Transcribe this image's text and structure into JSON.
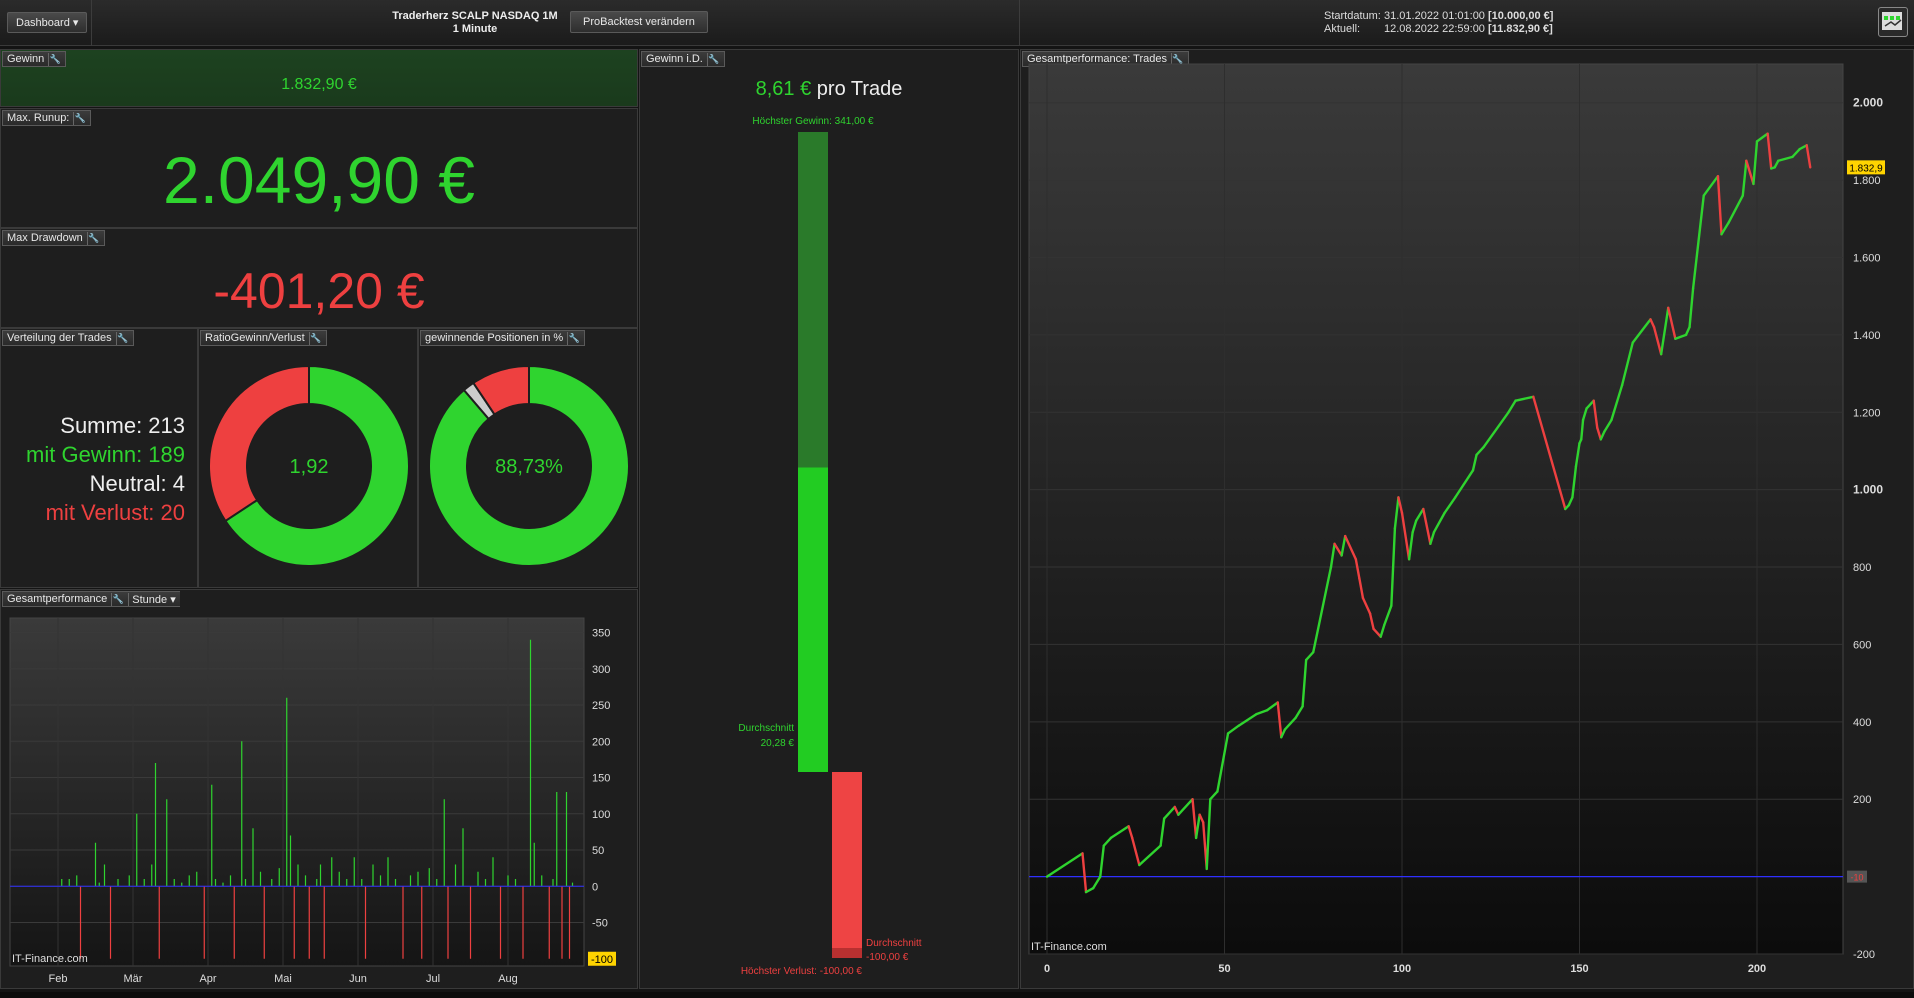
{
  "topbar": {
    "dashboard_label": "Dashboard",
    "title_line1": "Traderherz SCALP NASDAQ 1M",
    "title_line2": "1 Minute",
    "probacktest_label": "ProBacktest verändern",
    "start_label": "Startdatum:",
    "start_date": "31.01.2022 01:01:00",
    "start_value": "[10.000,00 €]",
    "current_label": "Aktuell:",
    "current_date": "12.08.2022 22:59:00",
    "current_value": "[11.832,90 €]"
  },
  "gewinn": {
    "title": "Gewinn",
    "value": "1.832,90 €"
  },
  "runup": {
    "title": "Max. Runup:",
    "value": "2.049,90 €"
  },
  "drawdown": {
    "title": "Max Drawdown",
    "value": "-401,20 €"
  },
  "verteilung": {
    "title": "Verteilung der Trades",
    "summe": "Summe: 213",
    "gewinn": "mit Gewinn: 189",
    "neutral": "Neutral: 4",
    "verlust": "mit Verlust: 20"
  },
  "ratio": {
    "title": "RatioGewinn/Verlust",
    "value": "1,92",
    "win_fraction": 0.6575
  },
  "winpct": {
    "title": "gewinnende Positionen in %",
    "value": "88,73%",
    "win_fraction": 0.8873,
    "neutral_fraction": 0.0188
  },
  "gesamt_hour": {
    "title": "Gesamtperformance",
    "period_label": "Stunde",
    "watermark": "IT-Finance.com",
    "y_ticks": [
      "350",
      "300",
      "250",
      "200",
      "150",
      "100",
      "50",
      "0",
      "-50"
    ],
    "y_marker": "-100",
    "x_ticks": [
      "Feb",
      "Mär",
      "Apr",
      "Mai",
      "Jun",
      "Jul",
      "Aug"
    ]
  },
  "gewinn_id": {
    "title": "Gewinn i.D.",
    "per_trade_value": "8,61 €",
    "per_trade_suffix": "pro Trade",
    "max_gain_label": "Höchster Gewinn: 341,00 €",
    "avg_win_label": "Durchschnitt",
    "avg_win_value": "20,28 €",
    "avg_loss_label": "Durchschnitt",
    "avg_loss_value": "-100,00 €",
    "max_loss_label": "Höchster Verlust: -100,00 €"
  },
  "trades_chart": {
    "title": "Gesamtperformance: Trades",
    "watermark": "IT-Finance.com",
    "y_ticks": [
      "2.000",
      "1.800",
      "1.600",
      "1.400",
      "1.200",
      "1.000",
      "800",
      "600",
      "400",
      "200",
      "-200"
    ],
    "x_ticks": [
      "0",
      "50",
      "100",
      "150",
      "200"
    ],
    "last_value_label": "1.832,9",
    "zero_marker": "-10"
  },
  "chart_data": [
    {
      "type": "line",
      "title": "",
      "xlabel": "",
      "ylabel": "",
      "xlim": [
        0,
        220
      ],
      "ylim": [
        -200,
        2100
      ],
      "grid": true,
      "series": [
        {
          "x": [
            0,
            10,
            11,
            13,
            15,
            16,
            18,
            23,
            24,
            26,
            32,
            33,
            36,
            37,
            41,
            42,
            43,
            44,
            45,
            46,
            48,
            51,
            54,
            59,
            62,
            65,
            66,
            67,
            70,
            72,
            73,
            75,
            80,
            81,
            83,
            84,
            87,
            88,
            89,
            91,
            92,
            94,
            95,
            97,
            98,
            99,
            100,
            102,
            103,
            104,
            106,
            108,
            109,
            112,
            115,
            120,
            121,
            123,
            130,
            132,
            137,
            146,
            147,
            148,
            149,
            150,
            150.5,
            151,
            152,
            154,
            155,
            156,
            157,
            159,
            162,
            165,
            170,
            171,
            173,
            175,
            177,
            180,
            181,
            182,
            185,
            189,
            190,
            192,
            196,
            197,
            199,
            200,
            203,
            204,
            205,
            206,
            210,
            211,
            212,
            214,
            215
          ],
          "y": [
            0,
            60,
            -40,
            -30,
            0,
            80,
            100,
            130,
            100,
            30,
            80,
            150,
            180,
            160,
            200,
            100,
            160,
            140,
            20,
            200,
            220,
            370,
            390,
            420,
            430,
            450,
            360,
            380,
            410,
            440,
            560,
            580,
            800,
            860,
            830,
            880,
            820,
            770,
            720,
            680,
            640,
            620,
            650,
            700,
            900,
            980,
            940,
            820,
            890,
            920,
            950,
            860,
            890,
            940,
            980,
            1050,
            1090,
            1110,
            1200,
            1230,
            1240,
            950,
            960,
            980,
            1060,
            1120,
            1130,
            1180,
            1210,
            1230,
            1160,
            1130,
            1150,
            1180,
            1270,
            1380,
            1440,
            1420,
            1350,
            1470,
            1390,
            1400,
            1420,
            1520,
            1760,
            1810,
            1660,
            1690,
            1760,
            1850,
            1790,
            1900,
            1920,
            1830,
            1832.9,
            1850,
            1860,
            1870,
            1880,
            1890,
            1832.9
          ]
        }
      ]
    },
    {
      "type": "bar",
      "title": "",
      "xlabel": "",
      "ylabel": "",
      "ylim": [
        -110,
        370
      ],
      "grid": true,
      "x_start": "Feb",
      "bars": [
        {
          "m": 0.05,
          "v": 10
        },
        {
          "m": 0.15,
          "v": 10
        },
        {
          "m": 0.25,
          "v": 15
        },
        {
          "m": 0.3,
          "v": -100
        },
        {
          "m": 0.5,
          "v": 60
        },
        {
          "m": 0.55,
          "v": 5
        },
        {
          "m": 0.62,
          "v": 30
        },
        {
          "m": 0.7,
          "v": -100
        },
        {
          "m": 0.8,
          "v": 10
        },
        {
          "m": 0.95,
          "v": 15
        },
        {
          "m": 1.05,
          "v": 100
        },
        {
          "m": 1.15,
          "v": 10
        },
        {
          "m": 1.25,
          "v": 30
        },
        {
          "m": 1.3,
          "v": 170
        },
        {
          "m": 1.35,
          "v": -100
        },
        {
          "m": 1.45,
          "v": 120
        },
        {
          "m": 1.55,
          "v": 10
        },
        {
          "m": 1.65,
          "v": 5
        },
        {
          "m": 1.75,
          "v": 15
        },
        {
          "m": 1.85,
          "v": 20
        },
        {
          "m": 1.95,
          "v": -100
        },
        {
          "m": 2.05,
          "v": 140
        },
        {
          "m": 2.1,
          "v": 10
        },
        {
          "m": 2.2,
          "v": 5
        },
        {
          "m": 2.3,
          "v": 15
        },
        {
          "m": 2.35,
          "v": -100
        },
        {
          "m": 2.45,
          "v": 200
        },
        {
          "m": 2.5,
          "v": 10
        },
        {
          "m": 2.6,
          "v": 80
        },
        {
          "m": 2.7,
          "v": 20
        },
        {
          "m": 2.75,
          "v": -100
        },
        {
          "m": 2.85,
          "v": 10
        },
        {
          "m": 2.95,
          "v": 25
        },
        {
          "m": 3.05,
          "v": 260
        },
        {
          "m": 3.1,
          "v": 70
        },
        {
          "m": 3.15,
          "v": -100
        },
        {
          "m": 3.2,
          "v": 30
        },
        {
          "m": 3.3,
          "v": 15
        },
        {
          "m": 3.35,
          "v": -100
        },
        {
          "m": 3.45,
          "v": 10
        },
        {
          "m": 3.5,
          "v": 30
        },
        {
          "m": 3.55,
          "v": -100
        },
        {
          "m": 3.65,
          "v": 40
        },
        {
          "m": 3.75,
          "v": 20
        },
        {
          "m": 3.85,
          "v": 10
        },
        {
          "m": 3.95,
          "v": 40
        },
        {
          "m": 4.05,
          "v": 10
        },
        {
          "m": 4.1,
          "v": -100
        },
        {
          "m": 4.2,
          "v": 30
        },
        {
          "m": 4.3,
          "v": 15
        },
        {
          "m": 4.4,
          "v": 40
        },
        {
          "m": 4.5,
          "v": 10
        },
        {
          "m": 4.6,
          "v": -100
        },
        {
          "m": 4.7,
          "v": 15
        },
        {
          "m": 4.8,
          "v": 20
        },
        {
          "m": 4.85,
          "v": -100
        },
        {
          "m": 4.95,
          "v": 25
        },
        {
          "m": 5.05,
          "v": 10
        },
        {
          "m": 5.15,
          "v": 120
        },
        {
          "m": 5.2,
          "v": -100
        },
        {
          "m": 5.3,
          "v": 30
        },
        {
          "m": 5.4,
          "v": 80
        },
        {
          "m": 5.5,
          "v": -100
        },
        {
          "m": 5.6,
          "v": 20
        },
        {
          "m": 5.7,
          "v": 10
        },
        {
          "m": 5.8,
          "v": 40
        },
        {
          "m": 5.9,
          "v": -100
        },
        {
          "m": 6.0,
          "v": 15
        },
        {
          "m": 6.1,
          "v": 10
        },
        {
          "m": 6.2,
          "v": -100
        },
        {
          "m": 6.3,
          "v": 340
        },
        {
          "m": 6.35,
          "v": 60
        },
        {
          "m": 6.45,
          "v": 15
        },
        {
          "m": 6.55,
          "v": -100
        },
        {
          "m": 6.6,
          "v": 10
        },
        {
          "m": 6.65,
          "v": 130
        },
        {
          "m": 6.72,
          "v": -100
        },
        {
          "m": 6.78,
          "v": 130
        },
        {
          "m": 6.82,
          "v": -100
        },
        {
          "m": 6.86,
          "v": 5
        }
      ]
    },
    {
      "type": "bar",
      "title": "",
      "xlabel": "",
      "ylabel": "",
      "categories": [
        "Höchster Gewinn",
        "Durchschnitt Gewinn",
        "Durchschnitt Verlust",
        "Höchster Verlust"
      ],
      "values": [
        341.0,
        20.28,
        -100.0,
        -100.0
      ],
      "ylim": [
        -110,
        350
      ]
    },
    {
      "type": "pie",
      "title": "",
      "categories": [
        "Gewinn",
        "Verlust"
      ],
      "values": [
        65.75,
        34.25
      ]
    },
    {
      "type": "pie",
      "title": "",
      "categories": [
        "Gewinn",
        "Neutral",
        "Verlust"
      ],
      "values": [
        189,
        4,
        20
      ]
    }
  ],
  "colors": {
    "win": "#2fd42f",
    "loss": "#ee4040",
    "neutral": "#cccccc",
    "zero_line": "#2f2fff",
    "marker": "#ffd400"
  }
}
